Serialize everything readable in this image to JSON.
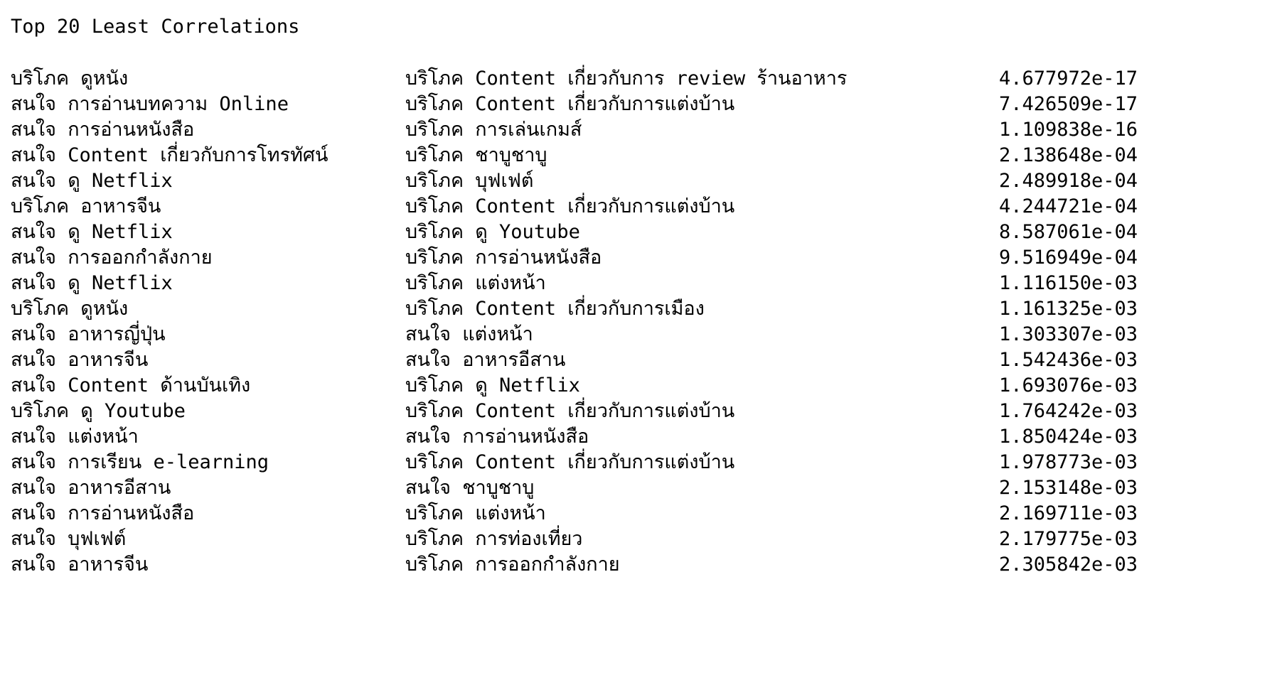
{
  "title": "Top 20 Least Correlations",
  "rows": [
    {
      "var1": "บริโภค ดูหนัง",
      "var2": "บริโภค Content เกี่ยวกับการ review ร้านอาหาร",
      "value": "4.677972e-17"
    },
    {
      "var1": "สนใจ การอ่านบทความ Online",
      "var2": "บริโภค Content เกี่ยวกับการแต่งบ้าน",
      "value": "7.426509e-17"
    },
    {
      "var1": "สนใจ การอ่านหนังสือ",
      "var2": "บริโภค การเล่นเกมส์",
      "value": "1.109838e-16"
    },
    {
      "var1": "สนใจ Content เกี่ยวกับการโทรทัศน์",
      "var2": "บริโภค ชาบูชาบู",
      "value": "2.138648e-04"
    },
    {
      "var1": "สนใจ ดู Netflix",
      "var2": "บริโภค บุฟเฟต์",
      "value": "2.489918e-04"
    },
    {
      "var1": "บริโภค อาหารจีน",
      "var2": "บริโภค Content เกี่ยวกับการแต่งบ้าน",
      "value": "4.244721e-04"
    },
    {
      "var1": "สนใจ ดู Netflix",
      "var2": "บริโภค ดู Youtube",
      "value": "8.587061e-04"
    },
    {
      "var1": "สนใจ การออกกำลังกาย",
      "var2": "บริโภค การอ่านหนังสือ",
      "value": "9.516949e-04"
    },
    {
      "var1": "สนใจ ดู Netflix",
      "var2": "บริโภค แต่งหน้า",
      "value": "1.116150e-03"
    },
    {
      "var1": "บริโภค ดูหนัง",
      "var2": "บริโภค Content เกี่ยวกับการเมือง",
      "value": "1.161325e-03"
    },
    {
      "var1": "สนใจ อาหารญี่ปุ่น",
      "var2": "สนใจ แต่งหน้า",
      "value": "1.303307e-03"
    },
    {
      "var1": "สนใจ อาหารจีน",
      "var2": "สนใจ อาหารอีสาน",
      "value": "1.542436e-03"
    },
    {
      "var1": "สนใจ Content ด้านบันเทิง",
      "var2": "บริโภค ดู Netflix",
      "value": "1.693076e-03"
    },
    {
      "var1": "บริโภค ดู Youtube",
      "var2": "บริโภค Content เกี่ยวกับการแต่งบ้าน",
      "value": "1.764242e-03"
    },
    {
      "var1": "สนใจ แต่งหน้า",
      "var2": "สนใจ การอ่านหนังสือ",
      "value": "1.850424e-03"
    },
    {
      "var1": "สนใจ การเรียน e-learning",
      "var2": "บริโภค Content เกี่ยวกับการแต่งบ้าน",
      "value": "1.978773e-03"
    },
    {
      "var1": "สนใจ อาหารอีสาน",
      "var2": "สนใจ ชาบูชาบู",
      "value": "2.153148e-03"
    },
    {
      "var1": "สนใจ การอ่านหนังสือ",
      "var2": "บริโภค แต่งหน้า",
      "value": "2.169711e-03"
    },
    {
      "var1": "สนใจ บุฟเฟต์",
      "var2": "บริโภค การท่องเที่ยว",
      "value": "2.179775e-03"
    },
    {
      "var1": "สนใจ อาหารจีน",
      "var2": "บริโภค การออกกำลังกาย",
      "value": "2.305842e-03"
    }
  ]
}
